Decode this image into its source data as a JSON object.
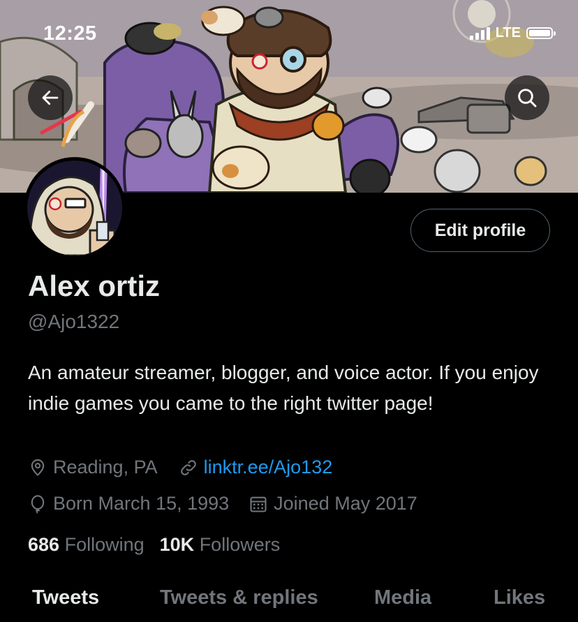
{
  "status_bar": {
    "time": "12:25",
    "network": "LTE"
  },
  "colors": {
    "accent": "#1d9bf0",
    "background": "#000000",
    "muted": "#71767b",
    "text": "#e7e9ea"
  },
  "header": {
    "back_icon": "arrow-left-icon",
    "search_icon": "search-icon"
  },
  "profile": {
    "display_name": "Alex ortiz",
    "handle": "@Ajo1322",
    "bio": "An amateur streamer, blogger, and voice actor. If you enjoy indie games you came to the right twitter page!",
    "location": "Reading, PA",
    "website": "linktr.ee/Ajo132",
    "birthday": "Born March 15, 1993",
    "joined": "Joined May 2017",
    "following_count": "686",
    "following_label": "Following",
    "followers_count": "10K",
    "followers_label": "Followers",
    "edit_button": "Edit profile"
  },
  "tabs": [
    {
      "label": "Tweets",
      "active": true
    },
    {
      "label": "Tweets & replies",
      "active": false
    },
    {
      "label": "Media",
      "active": false
    },
    {
      "label": "Likes",
      "active": false
    }
  ]
}
